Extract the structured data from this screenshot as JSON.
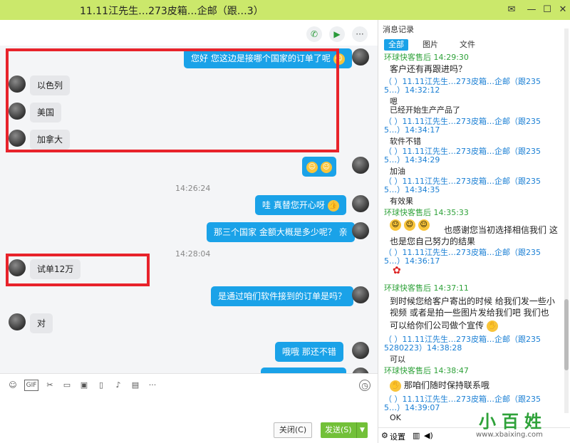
{
  "window": {
    "title": "11.11江先生…273皮箱…企邮（跟…3）"
  },
  "chat": {
    "messages": [
      {
        "dir": "out",
        "text": "您好  您这边是接哪个国家的订单了呢"
      },
      {
        "dir": "in",
        "text": "以色列"
      },
      {
        "dir": "in",
        "text": "美国"
      },
      {
        "dir": "in",
        "text": "加拿大"
      },
      {
        "dir": "out",
        "text": ""
      },
      {
        "dir": "out",
        "text": "哇   真替您开心呀"
      },
      {
        "dir": "out",
        "text": "那三个国家 金额大概是多少呢？ 亲"
      },
      {
        "dir": "in",
        "text": "试单12万"
      },
      {
        "dir": "out",
        "text": "是通过咱们软件接到的订单是吗？"
      },
      {
        "dir": "in",
        "text": "对"
      },
      {
        "dir": "out",
        "text": "哦哦  那还不错"
      }
    ],
    "timestamps": [
      "14:26:24",
      "14:28:04"
    ]
  },
  "input": {
    "close_label": "关闭(C)",
    "send_label": "发送(S)"
  },
  "history": {
    "title": "消息记录",
    "tabs": [
      "全部",
      "图片",
      "文件"
    ],
    "entries": [
      {
        "sender": "环球快客售后 14:29:30",
        "text": "客户还有再跟进吗？"
      },
      {
        "sender": "（   ）11.11江先生…273皮箱…企邮（跟235",
        "sender2": "5…）14:32:12",
        "text": "嗯"
      },
      {
        "text": "已经开始生产产品了"
      },
      {
        "sender": "（   ）11.11江先生…273皮箱…企邮（跟235",
        "sender2": "5…）14:34:17",
        "text": "软件不错"
      },
      {
        "sender": "（   ）11.11江先生…273皮箱…企邮（跟235",
        "sender2": "5…）14:34:29",
        "text": "加油"
      },
      {
        "sender": "（   ）11.11江先生…273皮箱…企邮（跟235",
        "sender2": "5…）14:34:35",
        "text": "有效果"
      },
      {
        "sender": "环球快客售后 14:35:33",
        "text": "也感谢您当初选择相信我们   这",
        "text2": "也是您自己努力的结果"
      },
      {
        "sender": "（   ）11.11江先生…273皮箱…企邮（跟235",
        "sender2": "5…）14:36:17"
      },
      {
        "sender": "环球快客售后 14:37:11",
        "text": "到时候您给客户寄出的时候  给我们发一些小",
        "text2": "视频  或者是拍一些图片发给我们吧   我们也",
        "text3": "可以给你们公司做个宣传"
      },
      {
        "sender": "（   ）11.11江先生…273皮箱…企邮（跟235",
        "sender2": "5280223）14:38:28",
        "text": "可以"
      },
      {
        "sender": "环球快客售后 14:38:47",
        "text": "那咱们随时保持联系哦"
      },
      {
        "sender": "（   ）11.11江先生…273皮箱…企邮（跟235",
        "sender2": "5…）14:39:07",
        "text": "OK"
      }
    ],
    "settings_label": "设置"
  },
  "watermark": {
    "text": "小百姓",
    "url": "www.xbaixing.com"
  },
  "colors": {
    "titlebar": "#cbe86b",
    "outgoing_bubble": "#1aa2e8",
    "highlight_box": "#e8232b",
    "send_button": "#72c038"
  }
}
